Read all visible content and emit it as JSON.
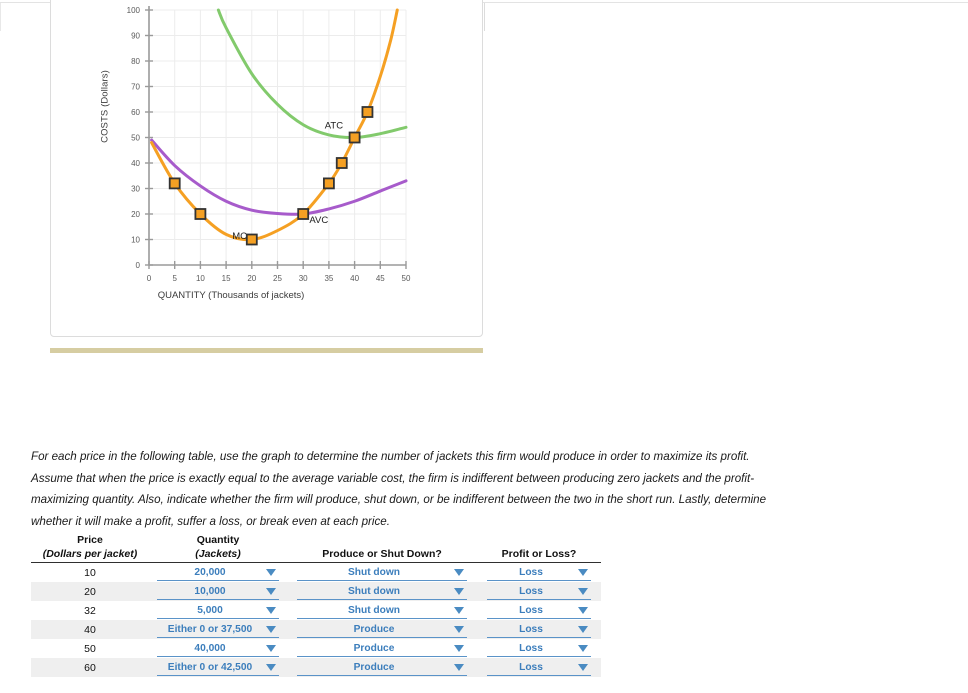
{
  "chart_data": {
    "type": "line",
    "title": "",
    "xlabel": "QUANTITY (Thousands of jackets)",
    "ylabel": "COSTS (Dollars)",
    "xlim": [
      0,
      50
    ],
    "ylim": [
      0,
      100
    ],
    "xticks": [
      0,
      5,
      10,
      15,
      20,
      25,
      30,
      35,
      40,
      45,
      50
    ],
    "yticks": [
      0,
      10,
      20,
      30,
      40,
      50,
      60,
      70,
      80,
      90,
      100
    ],
    "grid": true,
    "legend_position": "inline-labels",
    "series": [
      {
        "name": "MC",
        "label": "MC",
        "color": "#F5A023",
        "type": "line-with-markers",
        "points": [
          {
            "x": 0.5,
            "y": 48
          },
          {
            "x": 5,
            "y": 32
          },
          {
            "x": 10,
            "y": 20
          },
          {
            "x": 15,
            "y": 12
          },
          {
            "x": 20,
            "y": 10
          },
          {
            "x": 25,
            "y": 13.5
          },
          {
            "x": 30,
            "y": 20
          },
          {
            "x": 35,
            "y": 32
          },
          {
            "x": 37.5,
            "y": 40
          },
          {
            "x": 40,
            "y": 50
          },
          {
            "x": 42.5,
            "y": 60
          },
          {
            "x": 45,
            "y": 74
          },
          {
            "x": 47,
            "y": 88
          },
          {
            "x": 48.3,
            "y": 100
          }
        ],
        "markers": [
          {
            "x": 5,
            "y": 32
          },
          {
            "x": 10,
            "y": 20
          },
          {
            "x": 20,
            "y": 10
          },
          {
            "x": 30,
            "y": 20
          },
          {
            "x": 35,
            "y": 32
          },
          {
            "x": 37.5,
            "y": 40
          },
          {
            "x": 40,
            "y": 50
          },
          {
            "x": 42.5,
            "y": 60
          }
        ]
      },
      {
        "name": "AVC",
        "label": "AVC",
        "color": "#A75BCB",
        "type": "line",
        "points": [
          {
            "x": 0.5,
            "y": 49
          },
          {
            "x": 5,
            "y": 39
          },
          {
            "x": 10,
            "y": 31
          },
          {
            "x": 15,
            "y": 25
          },
          {
            "x": 20,
            "y": 21.5
          },
          {
            "x": 25,
            "y": 20.2
          },
          {
            "x": 30,
            "y": 20
          },
          {
            "x": 35,
            "y": 22
          },
          {
            "x": 40,
            "y": 25
          },
          {
            "x": 45,
            "y": 29
          },
          {
            "x": 50,
            "y": 33
          }
        ]
      },
      {
        "name": "ATC",
        "label": "ATC",
        "color": "#82CA6C",
        "type": "line",
        "points": [
          {
            "x": 13.5,
            "y": 100
          },
          {
            "x": 15,
            "y": 93
          },
          {
            "x": 20,
            "y": 75
          },
          {
            "x": 25,
            "y": 63
          },
          {
            "x": 30,
            "y": 55
          },
          {
            "x": 35,
            "y": 51
          },
          {
            "x": 40,
            "y": 50
          },
          {
            "x": 45,
            "y": 51.5
          },
          {
            "x": 50,
            "y": 54
          }
        ]
      }
    ],
    "curve_labels": [
      {
        "text": "ATC",
        "x": 34.2,
        "y": 53.5
      },
      {
        "text": "AVC",
        "x": 31.2,
        "y": 16.5
      },
      {
        "text": "MC",
        "x": 16.2,
        "y": 10.2
      }
    ]
  },
  "instructions": {
    "paragraph": "For each price in the following table, use the graph to determine the number of jackets this firm would produce in order to maximize its profit. Assume that when the price is exactly equal to the average variable cost, the firm is indifferent between producing zero jackets and the profit-maximizing quantity. Also, indicate whether the firm will produce, shut down, or be indifferent between the two in the short run. Lastly, determine whether it will make a profit, suffer a loss, or break even at each price."
  },
  "table": {
    "headers": [
      {
        "main": "Price",
        "sub": "(Dollars per jacket)"
      },
      {
        "main": "Quantity",
        "sub": "(Jackets)"
      },
      {
        "main": "",
        "sub": "Produce or Shut Down?"
      },
      {
        "main": "",
        "sub": "Profit or Loss?"
      }
    ],
    "rows": [
      {
        "price": "10",
        "quantity": "20,000",
        "decision": "Shut down",
        "outcome": "Loss"
      },
      {
        "price": "20",
        "quantity": "10,000",
        "decision": "Shut down",
        "outcome": "Loss"
      },
      {
        "price": "32",
        "quantity": "5,000",
        "decision": "Shut down",
        "outcome": "Loss"
      },
      {
        "price": "40",
        "quantity": "Either 0 or 37,500",
        "decision": "Produce",
        "outcome": "Loss"
      },
      {
        "price": "50",
        "quantity": "40,000",
        "decision": "Produce",
        "outcome": "Loss"
      },
      {
        "price": "60",
        "quantity": "Either 0 or 42,500",
        "decision": "Produce",
        "outcome": "Loss"
      }
    ]
  },
  "colors": {
    "mc": "#F5A023",
    "avc": "#A75BCB",
    "atc": "#82CA6C",
    "dropdown_blue": "#3c7ebc",
    "divider_khaki": "#d6cda2"
  }
}
